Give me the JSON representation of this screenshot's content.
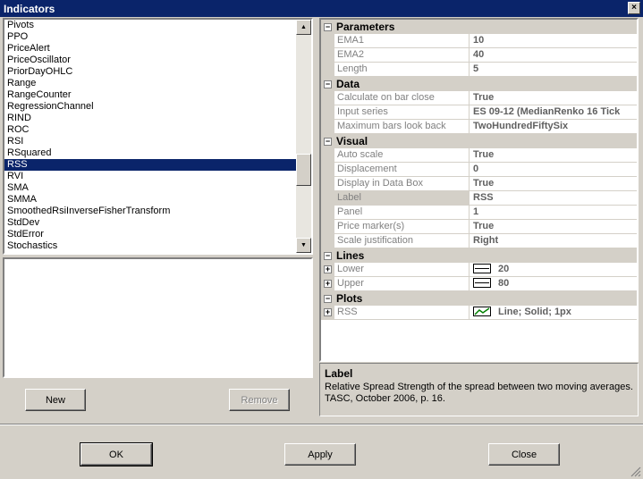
{
  "window": {
    "title": "Indicators",
    "close_glyph": "×"
  },
  "indicator_list": {
    "items": [
      "Pivots",
      "PPO",
      "PriceAlert",
      "PriceOscillator",
      "PriorDayOHLC",
      "Range",
      "RangeCounter",
      "RegressionChannel",
      "RIND",
      "ROC",
      "RSI",
      "RSquared",
      "RSS",
      "RVI",
      "SMA",
      "SMMA",
      "SmoothedRsiInverseFisherTransform",
      "StdDev",
      "StdError",
      "Stochastics"
    ],
    "selected_index": 12
  },
  "buttons": {
    "new": "New",
    "remove": "Remove",
    "ok": "OK",
    "apply": "Apply",
    "close": "Close"
  },
  "properties": {
    "categories": [
      {
        "name": "Parameters",
        "toggle": "−",
        "rows": [
          {
            "name": "EMA1",
            "value": "10"
          },
          {
            "name": "EMA2",
            "value": "40"
          },
          {
            "name": "Length",
            "value": "5"
          }
        ]
      },
      {
        "name": "Data",
        "toggle": "−",
        "rows": [
          {
            "name": "Calculate on bar close",
            "value": "True"
          },
          {
            "name": "Input series",
            "value": "ES 09-12 (MedianRenko 16 Tick"
          },
          {
            "name": "Maximum bars look back",
            "value": "TwoHundredFiftySix"
          }
        ]
      },
      {
        "name": "Visual",
        "toggle": "−",
        "rows": [
          {
            "name": "Auto scale",
            "value": "True"
          },
          {
            "name": "Displacement",
            "value": "0"
          },
          {
            "name": "Display in Data Box",
            "value": "True"
          },
          {
            "name": "Label",
            "value": "RSS",
            "selected": true
          },
          {
            "name": "Panel",
            "value": "1"
          },
          {
            "name": "Price marker(s)",
            "value": "True"
          },
          {
            "name": "Scale justification",
            "value": "Right"
          }
        ]
      },
      {
        "name": "Lines",
        "toggle": "−",
        "rows": [
          {
            "name": "Lower",
            "value": "20",
            "expand": "+",
            "swatch": "line-icon"
          },
          {
            "name": "Upper",
            "value": "80",
            "expand": "+",
            "swatch": "line-icon"
          }
        ]
      },
      {
        "name": "Plots",
        "toggle": "−",
        "rows": [
          {
            "name": "RSS",
            "value": "Line; Solid; 1px",
            "expand": "+",
            "swatch": "plot-line-icon",
            "swatch_color": "#008000"
          }
        ]
      }
    ]
  },
  "help": {
    "title": "Label",
    "description": "Relative Spread Strength of the spread between two moving averages. TASC, October 2006, p. 16."
  }
}
